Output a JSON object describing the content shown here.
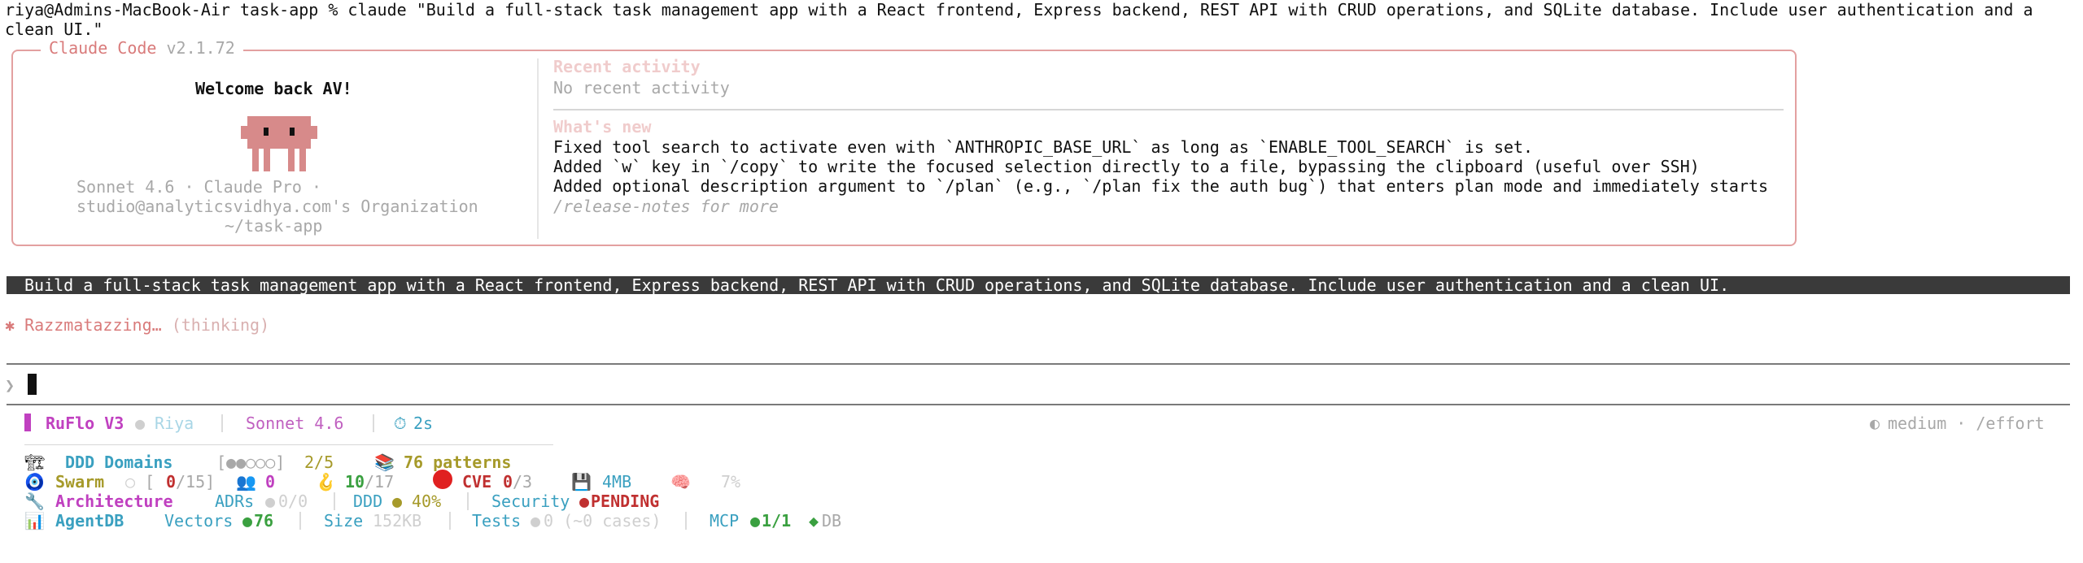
{
  "terminal": {
    "command_line_1": "riya@Admins-MacBook-Air task-app % claude \"Build a full-stack task management app with a React frontend, Express backend, REST API with CRUD operations, and SQLite database. Include user authentication and a",
    "command_line_2": "clean UI.\""
  },
  "claude_code": {
    "title_name": "Claude Code",
    "version": "v2.1.72",
    "welcome": "Welcome back AV!",
    "model_line": "Sonnet 4.6 · Claude Pro ·",
    "org_line": "studio@analyticsvidhya.com's Organization",
    "cwd": "~/task-app",
    "recent_activity_heading": "Recent activity",
    "recent_activity_text": "No recent activity",
    "whats_new_heading": "What's new",
    "whats_new_items": [
      "Fixed tool search to activate even with `ANTHROPIC_BASE_URL` as long as `ENABLE_TOOL_SEARCH` is set.",
      "Added `w` key in `/copy` to write the focused selection directly to a file, bypassing the clipboard (useful over SSH)",
      "Added optional description argument to `/plan` (e.g., `/plan fix the auth bug`) that enters plan mode and immediately starts"
    ],
    "release_notes": "/release-notes for more"
  },
  "prompt": "Build a full-stack task management app with a React frontend, Express backend, REST API with CRUD operations, and SQLite database. Include user authentication and a clean UI.",
  "status": {
    "spinner_glyph": "✱",
    "word": "Razzmatazzing…",
    "detail": "(thinking)"
  },
  "input": {
    "caret": "❯"
  },
  "statusline": {
    "brand": "RuFlo V3",
    "user": "Riya",
    "model": "Sonnet 4.6",
    "timer": "2s",
    "effort": "medium · /effort",
    "ddd_label": "DDD Domains",
    "ddd_dots": "[●●○○○]",
    "ddd_count": "2/5",
    "patterns": "76 patterns",
    "swarm_label": "Swarm",
    "swarm_agents_open": "[",
    "swarm_agents_value": "0",
    "swarm_agents_total": "/15]",
    "swarm_people": "0",
    "swarm_hooks": "10",
    "swarm_hooks_total": "/17",
    "cve_label": "CVE",
    "cve_value": "0",
    "cve_total": "/3",
    "mem": "4MB",
    "mem_pct": "7%",
    "arch_label": "Architecture",
    "adrs": "ADRs",
    "adrs_value": "0/0",
    "ddd_pct_label": "DDD",
    "ddd_pct": "40%",
    "security_label": "Security",
    "security_value": "PENDING",
    "agentdb_label": "AgentDB",
    "vectors_label": "Vectors",
    "vectors_value": "76",
    "size_label": "Size",
    "size_value": "152KB",
    "tests_label": "Tests",
    "tests_value": "0 (~0 cases)",
    "mcp_label": "MCP",
    "mcp_value": "1/1",
    "db_label": "DB"
  },
  "colors": {
    "accent_pink": "#d97b7b",
    "brand_magenta": "#c040c0",
    "teal": "#3aa0c0",
    "green": "#3aa040",
    "olive": "#a69a2a",
    "red": "#c03030"
  }
}
